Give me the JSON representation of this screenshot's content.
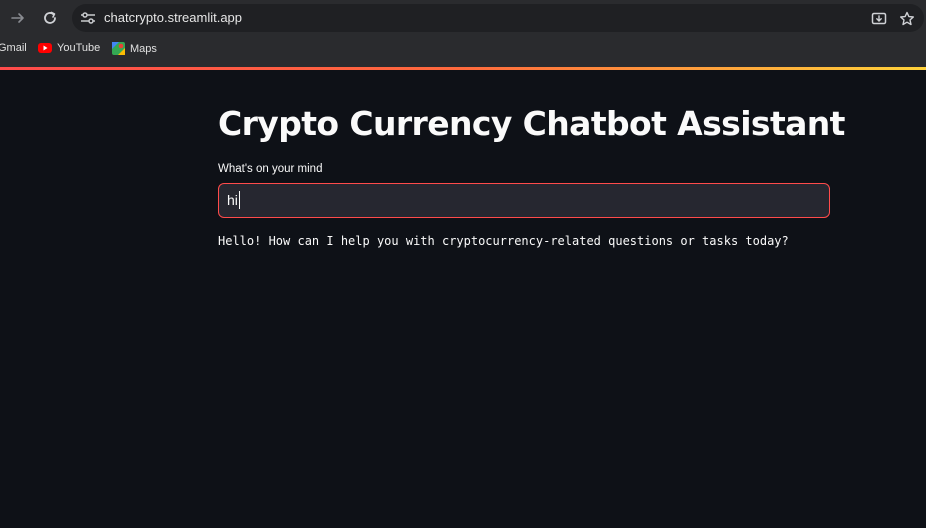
{
  "browser": {
    "url": "chatcrypto.streamlit.app",
    "bookmarks": [
      {
        "label": "Gmail",
        "icon": "gmail-icon"
      },
      {
        "label": "YouTube",
        "icon": "youtube-icon"
      },
      {
        "label": "Maps",
        "icon": "maps-icon"
      }
    ],
    "icons": {
      "forward": "forward-arrow-icon",
      "reload": "reload-icon",
      "site_settings": "tune-icon",
      "install_app": "install-app-icon",
      "bookmark_star": "star-icon"
    }
  },
  "app": {
    "title": "Crypto Currency Chatbot Assistant",
    "input_label": "What's on your mind",
    "input_value": "hi",
    "response": "Hello! How can I help you with cryptocurrency-related questions or tasks today?"
  },
  "colors": {
    "background": "#0e1117",
    "input_background": "#262730",
    "accent": "#ff4b4b",
    "text": "#fafafa",
    "browser_chrome": "#2a2b2e"
  }
}
